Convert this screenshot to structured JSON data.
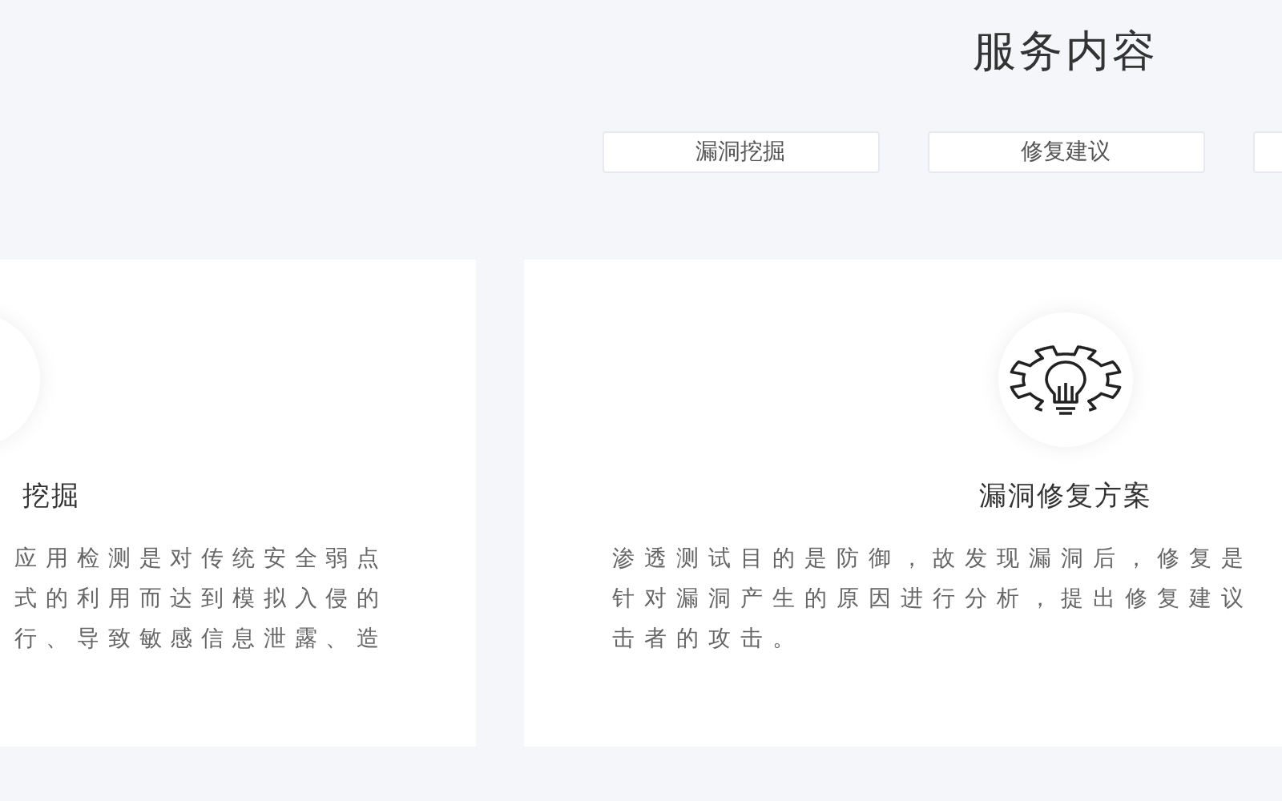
{
  "section_title": "服务内容",
  "tabs": [
    {
      "label": "漏洞挖掘"
    },
    {
      "label": "修复建议"
    }
  ],
  "cards": [
    {
      "kind": "left",
      "title": "挖掘",
      "lines": [
        "应用检测是对传统安全弱点",
        "式的利用而达到模拟入侵的",
        "行、导致敏感信息泄露、造"
      ]
    },
    {
      "kind": "right",
      "title": "漏洞修复方案",
      "lines": [
        "渗透测试目的是防御，故发现漏洞后，修复是",
        "针对漏洞产生的原因进行分析，提出修复建议",
        "击者的攻击。"
      ]
    }
  ]
}
